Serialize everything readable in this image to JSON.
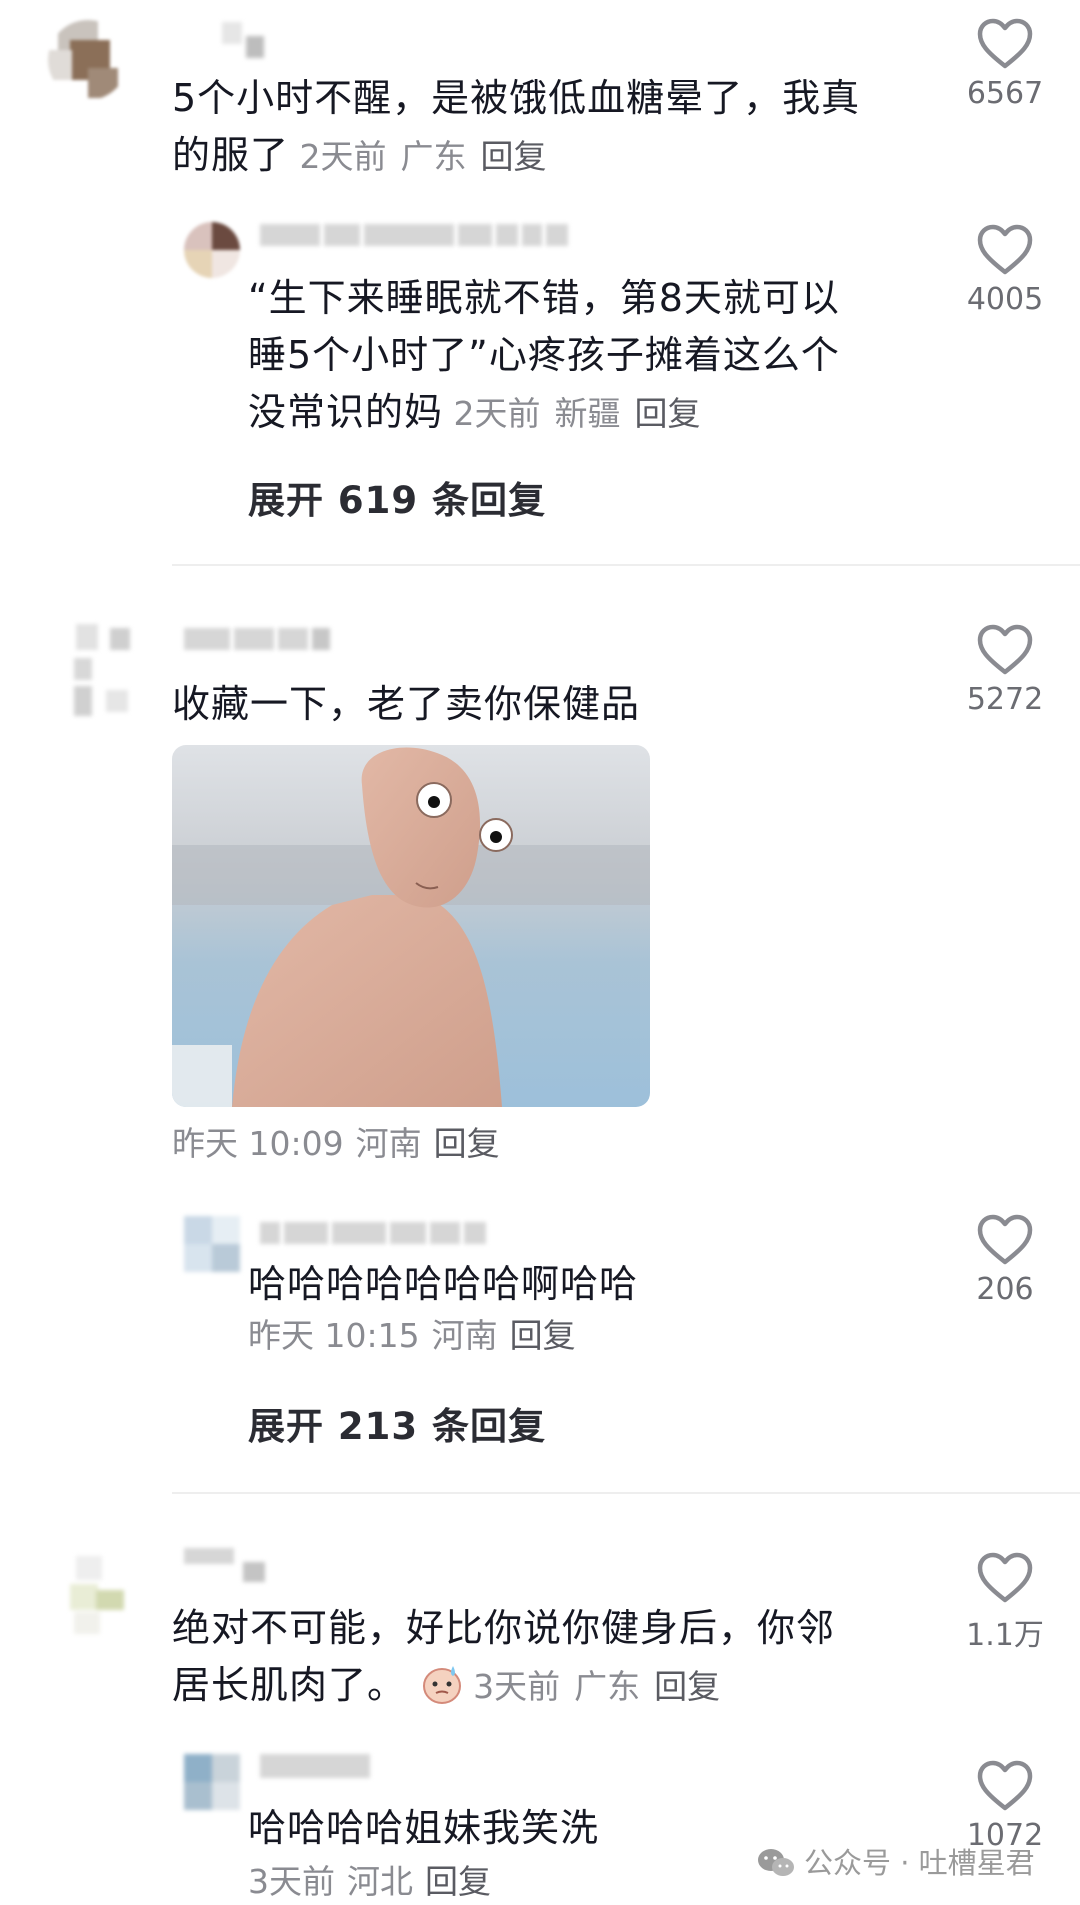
{
  "comments": [
    {
      "text": "5个小时不醒，是被饿低血糖晕了，我真的服了",
      "line1": "5个小时不醒，是被饿低血糖晕了，我真",
      "line2": "的服了",
      "time": "2天前",
      "location": "广东",
      "reply_label": "回复",
      "likes": "6567",
      "replies": [
        {
          "line1": "“生下来睡眠就不错，第8天就可以",
          "line2": "睡5个小时了”心疼孩子摊着这么个",
          "line3": "没常识的妈",
          "time": "2天前",
          "location": "新疆",
          "reply_label": "回复",
          "likes": "4005"
        }
      ],
      "expand_label": "展开 619 条回复"
    },
    {
      "text": "收藏一下，老了卖你保健品",
      "time": "昨天 10:09",
      "location": "河南",
      "reply_label": "回复",
      "likes": "5272",
      "image": "meme-doll-image",
      "replies": [
        {
          "line1": "哈哈哈哈哈哈哈啊哈哈",
          "time": "昨天 10:15",
          "location": "河南",
          "reply_label": "回复",
          "likes": "206"
        }
      ],
      "expand_label": "展开 213 条回复"
    },
    {
      "line1": "绝对不可能，好比你说你健身后，你邻",
      "line2": "居长肌肉了。",
      "time": "3天前",
      "location": "广东",
      "reply_label": "回复",
      "likes": "1.1万",
      "replies": [
        {
          "line1": "哈哈哈哈姐妹我笑洗",
          "time": "3天前",
          "location": "河北",
          "reply_label": "回复",
          "likes": "1072"
        }
      ]
    }
  ],
  "watermark": "公众号 · 吐槽星君",
  "colors": {
    "text": "#161823",
    "meta": "#8a8b91",
    "like_icon": "#8a8b91"
  }
}
